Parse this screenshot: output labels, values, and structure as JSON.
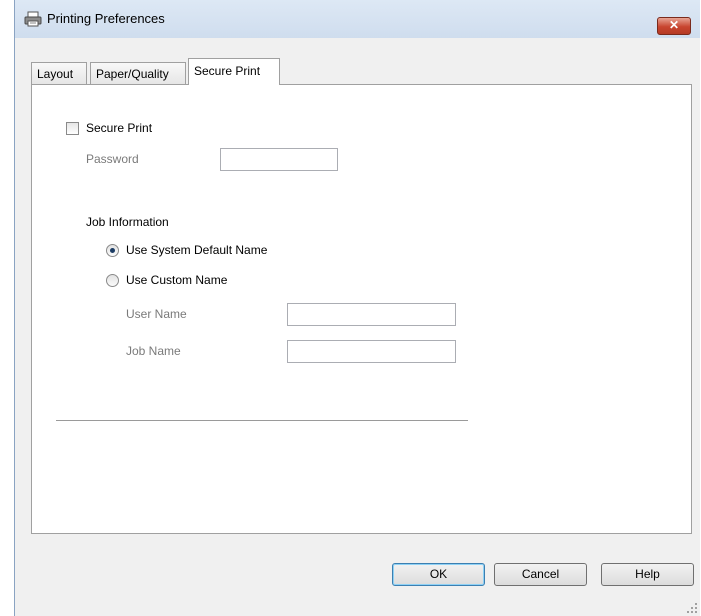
{
  "window": {
    "title": "Printing Preferences",
    "close_label": "✕"
  },
  "tabs": [
    {
      "label": "Layout",
      "active": false
    },
    {
      "label": "Paper/Quality",
      "active": false
    },
    {
      "label": "Secure Print",
      "active": true
    }
  ],
  "secure_print": {
    "checkbox_label": "Secure Print",
    "checked": false,
    "password_label": "Password",
    "password_value": ""
  },
  "job_information": {
    "heading": "Job Information",
    "system_default_label": "Use System Default Name",
    "custom_name_label": "Use Custom Name",
    "selected": "system_default",
    "user_name_label": "User Name",
    "user_name_value": "",
    "job_name_label": "Job Name",
    "job_name_value": ""
  },
  "buttons": {
    "ok": "OK",
    "cancel": "Cancel",
    "help": "Help"
  },
  "colors": {
    "title_bar": "#cfddee",
    "close_button": "#c8452f",
    "default_button_border": "#3c7fb1"
  }
}
